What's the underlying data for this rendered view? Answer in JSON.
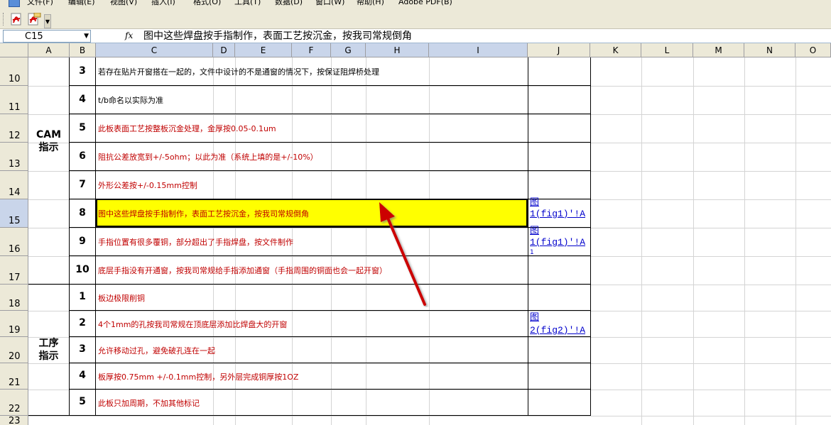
{
  "menubar": {
    "items": [
      "文件(F)",
      "编辑(E)",
      "视图(V)",
      "插入(I)",
      "格式(O)",
      "工具(T)",
      "数据(D)",
      "窗口(W)",
      "帮助(H)",
      "Adobe PDF(B)"
    ]
  },
  "formula_bar": {
    "cell_ref": "C15",
    "fx": "fx",
    "content": "图中这些焊盘按手指制作，表面工艺按沉金，按我司常规倒角"
  },
  "columns": [
    "A",
    "B",
    "C",
    "D",
    "E",
    "F",
    "G",
    "H",
    "I",
    "J",
    "K",
    "L",
    "M",
    "N",
    "O"
  ],
  "rows": [
    "10",
    "11",
    "12",
    "13",
    "14",
    "15",
    "16",
    "17",
    "18",
    "19",
    "20",
    "21",
    "22",
    "23"
  ],
  "sections": {
    "cam": "CAM\n指示",
    "process": "工序\n指示"
  },
  "cam_items": [
    {
      "num": "3",
      "text": "若存在贴片开窗搭在一起的，文件中设计的不是通窗的情况下，按保证阻焊桥处理",
      "color": "black"
    },
    {
      "num": "4",
      "text": "t/b命名以实际为准",
      "color": "black"
    },
    {
      "num": "5",
      "text": "此板表面工艺按整板沉金处理，金厚按0.05-0.1um",
      "color": "red"
    },
    {
      "num": "6",
      "text": "阻抗公差放宽到+/-5ohm；以此为准（系统上填的是+/-10%）",
      "color": "red"
    },
    {
      "num": "7",
      "text": "外形公差按+/-0.15mm控制",
      "color": "red"
    },
    {
      "num": "8",
      "text": "图中这些焊盘按手指制作，表面工艺按沉金，按我司常规倒角",
      "color": "red"
    },
    {
      "num": "9",
      "text": "手指位置有很多覆铜，部分超出了手指焊盘，按文件制作",
      "color": "red"
    },
    {
      "num": "10",
      "text": "底层手指没有开通窗，按我司常规给手指添加通窗（手指周围的铜面也会一起开窗）",
      "color": "red"
    }
  ],
  "process_items": [
    {
      "num": "1",
      "text": "板边极限削铜",
      "color": "red"
    },
    {
      "num": "2",
      "text": "4个1mm的孔按我司常规在顶底层添加比焊盘大的开窗",
      "color": "red"
    },
    {
      "num": "3",
      "text": "允许移动过孔，避免破孔连在一起",
      "color": "red"
    },
    {
      "num": "4",
      "text": "板厚按0.75mm +/-0.1mm控制，另外层完成铜厚按1OZ",
      "color": "red"
    },
    {
      "num": "5",
      "text": "此板只加周期，不加其他标记",
      "color": "red"
    }
  ],
  "links": {
    "fig1_a_line1": "图",
    "fig1_a_line2": "1(fig1)'!A",
    "fig1_b_line1": "图",
    "fig1_b_line2": "1(fig1)'!A",
    "fig1_b_tail": "1",
    "fig2_line1": "图",
    "fig2_line2": "2(fig2)'!A"
  },
  "colors": {
    "highlight": "#ffff00",
    "red_text": "#c00000",
    "arrow": "#cc0000",
    "link": "#0000cc"
  }
}
